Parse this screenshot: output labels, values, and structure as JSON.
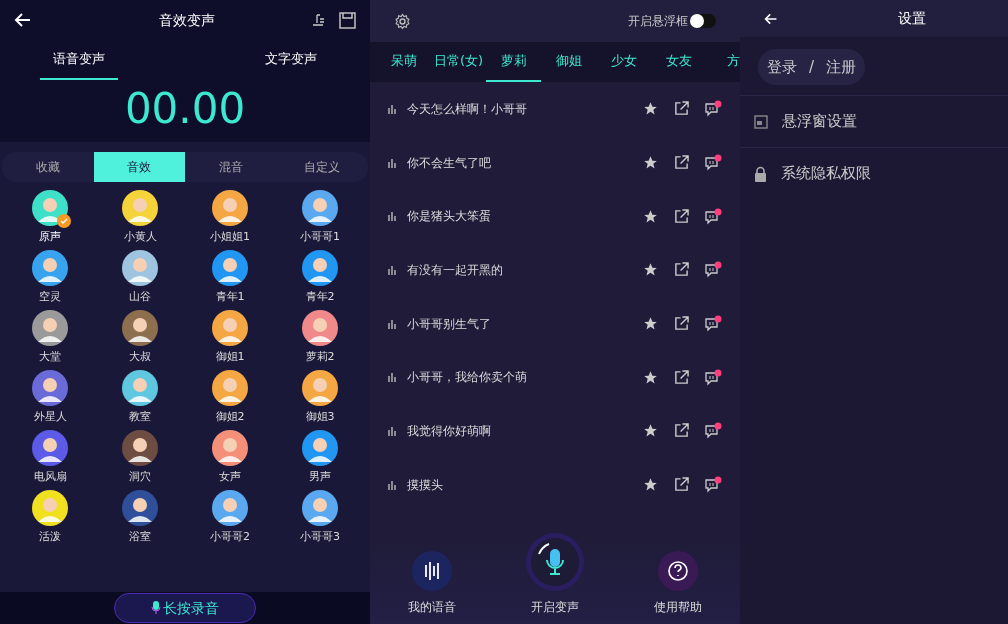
{
  "effects_screen": {
    "title": "音效变声",
    "mode_tabs": [
      {
        "label": "语音变声",
        "selected": true
      },
      {
        "label": "文字变声",
        "selected": false
      }
    ],
    "timer": "00.00",
    "category_tabs": [
      {
        "label": "收藏",
        "selected": false
      },
      {
        "label": "音效",
        "selected": true
      },
      {
        "label": "混音",
        "selected": false
      },
      {
        "label": "自定义",
        "selected": false
      }
    ],
    "effects": [
      {
        "label": "原声",
        "selected": true
      },
      {
        "label": "小黄人",
        "selected": false
      },
      {
        "label": "小姐姐1",
        "selected": false
      },
      {
        "label": "小哥哥1",
        "selected": false
      },
      {
        "label": "空灵",
        "selected": false
      },
      {
        "label": "山谷",
        "selected": false
      },
      {
        "label": "青年1",
        "selected": false
      },
      {
        "label": "青年2",
        "selected": false
      },
      {
        "label": "大堂",
        "selected": false
      },
      {
        "label": "大叔",
        "selected": false
      },
      {
        "label": "御姐1",
        "selected": false
      },
      {
        "label": "萝莉2",
        "selected": false
      },
      {
        "label": "外星人",
        "selected": false
      },
      {
        "label": "教室",
        "selected": false
      },
      {
        "label": "御姐2",
        "selected": false
      },
      {
        "label": "御姐3",
        "selected": false
      },
      {
        "label": "电风扇",
        "selected": false
      },
      {
        "label": "洞穴",
        "selected": false
      },
      {
        "label": "女声",
        "selected": false
      },
      {
        "label": "男声",
        "selected": false
      },
      {
        "label": "活泼",
        "selected": false
      },
      {
        "label": "浴室",
        "selected": false
      },
      {
        "label": "小哥哥2",
        "selected": false
      },
      {
        "label": "小哥哥3",
        "selected": false
      }
    ],
    "record_button": "长按录音"
  },
  "phrases_screen": {
    "float_toggle": {
      "label": "开启悬浮框",
      "on": false
    },
    "voice_tabs": [
      {
        "label": "呆萌",
        "selected": false
      },
      {
        "label": "日常(女)",
        "selected": false
      },
      {
        "label": "萝莉",
        "selected": true
      },
      {
        "label": "御姐",
        "selected": false
      },
      {
        "label": "少女",
        "selected": false
      },
      {
        "label": "女友",
        "selected": false
      },
      {
        "label": "方",
        "selected": false
      }
    ],
    "phrases": [
      "今天怎么样啊！小哥哥",
      "你不会生气了吧",
      "你是猪头大笨蛋",
      "有没有一起开黑的",
      "小哥哥别生气了",
      "小哥哥，我给你卖个萌",
      "我觉得你好萌啊",
      "摸摸头"
    ],
    "bottom_nav": [
      {
        "kind": "voice",
        "label": "我的语音"
      },
      {
        "kind": "mic",
        "label": "开启变声"
      },
      {
        "kind": "help",
        "label": "使用帮助"
      }
    ]
  },
  "settings_screen": {
    "title": "设置",
    "login": [
      "登录",
      "/",
      "注册"
    ],
    "items": [
      {
        "kind": "window",
        "label": "悬浮窗设置"
      },
      {
        "kind": "lock",
        "label": "系统隐私权限"
      }
    ]
  }
}
